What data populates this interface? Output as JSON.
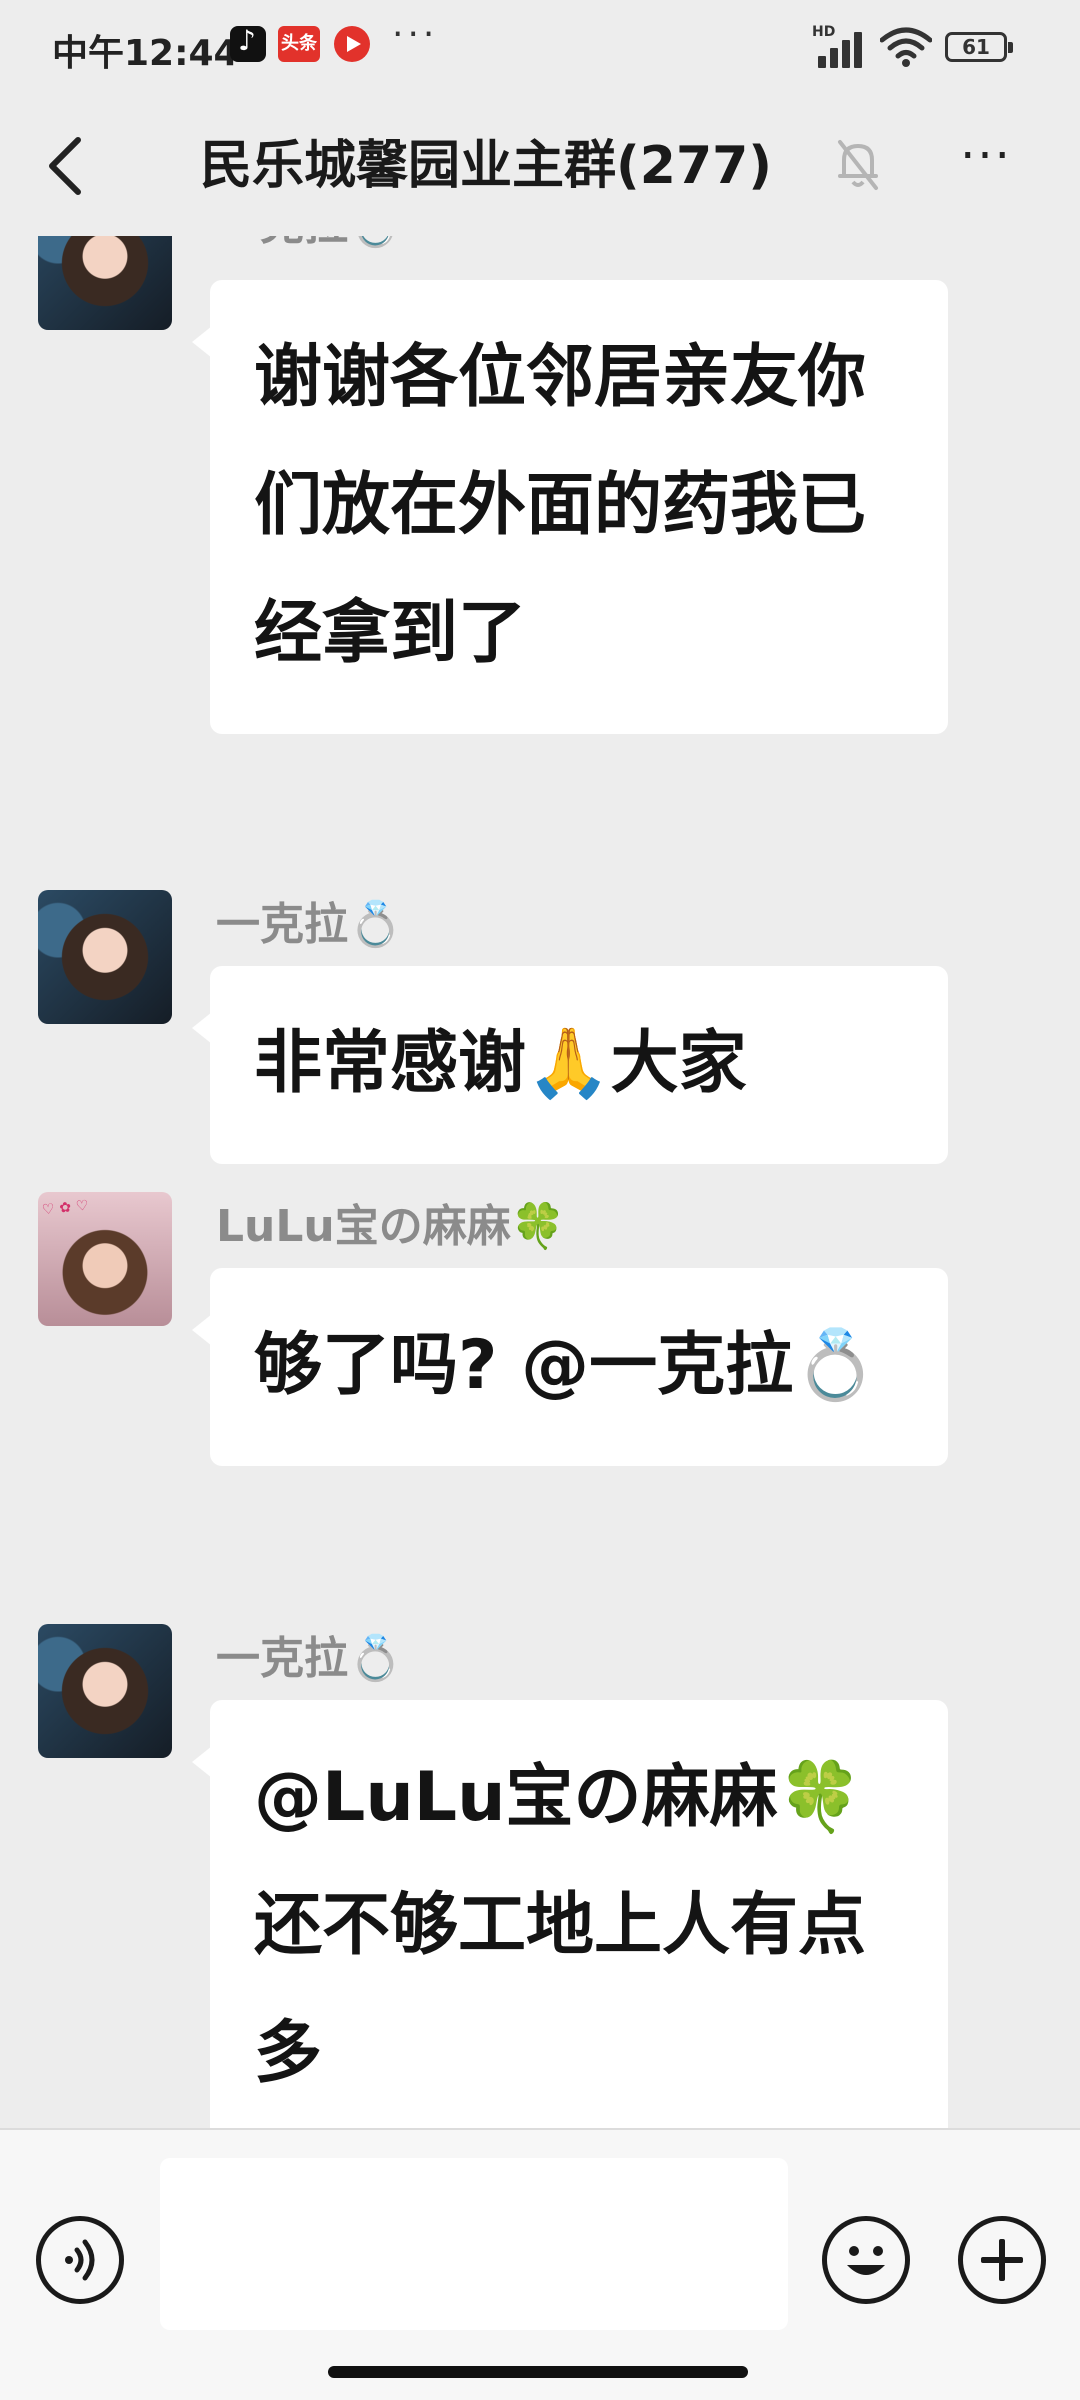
{
  "status_bar": {
    "time": "中午12:44",
    "toutiao_badge": "头条",
    "more": "···",
    "network": "HD",
    "battery": "61"
  },
  "header": {
    "title": "民乐城馨园业主群(277)",
    "more": "···"
  },
  "messages": [
    {
      "sender": "一克拉💍",
      "avatar": "avatar-yikela",
      "text": "谢谢各位邻居亲友你们放在外面的药我已经拿到了"
    },
    {
      "sender": "一克拉💍",
      "avatar": "avatar-yikela",
      "text": "非常感谢🙏大家"
    },
    {
      "sender": "LuLu宝の麻麻🍀",
      "avatar": "avatar-lulu",
      "text": "够了吗? @一克拉💍"
    },
    {
      "sender": "一克拉💍",
      "avatar": "avatar-yikela",
      "text": "@LuLu宝の麻麻🍀 还不够工地上人有点多"
    }
  ],
  "input_bar": {
    "placeholder": ""
  }
}
